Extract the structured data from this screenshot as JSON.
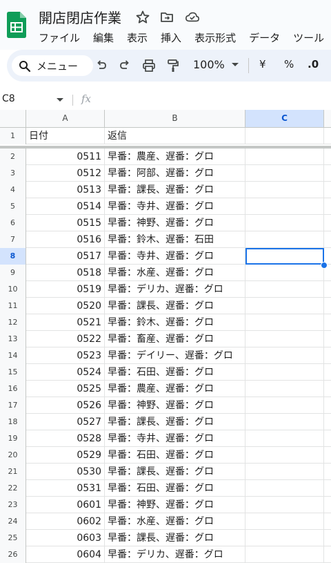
{
  "app": {
    "title": "開店閉店作業",
    "accent": "#0f9d58"
  },
  "menu": [
    "ファイル",
    "編集",
    "表示",
    "挿入",
    "表示形式",
    "データ",
    "ツール"
  ],
  "toolbar": {
    "search_label": "メニュー",
    "zoom": "100%",
    "currency": "¥",
    "percent": "%",
    "decimal": ".0"
  },
  "formula_bar": {
    "cell_ref": "C8",
    "fx": "fx"
  },
  "columns": [
    "A",
    "B",
    "C"
  ],
  "header_row": {
    "num": "1",
    "a": "日付",
    "b": "返信"
  },
  "rows": [
    {
      "num": "2",
      "a": "0511",
      "b": "早番：農産、遅番：グロ"
    },
    {
      "num": "3",
      "a": "0512",
      "b": "早番：阿部、遅番：グロ"
    },
    {
      "num": "4",
      "a": "0513",
      "b": "早番：課長、遅番：グロ"
    },
    {
      "num": "5",
      "a": "0514",
      "b": "早番：寺井、遅番：グロ"
    },
    {
      "num": "6",
      "a": "0515",
      "b": "早番：神野、遅番：グロ"
    },
    {
      "num": "7",
      "a": "0516",
      "b": "早番：鈴木、遅番：石田"
    },
    {
      "num": "8",
      "a": "0517",
      "b": "早番：寺井、遅番：グロ"
    },
    {
      "num": "9",
      "a": "0518",
      "b": "早番：水産、遅番：グロ"
    },
    {
      "num": "10",
      "a": "0519",
      "b": "早番：デリカ、遅番：グロ"
    },
    {
      "num": "11",
      "a": "0520",
      "b": "早番：課長、遅番：グロ"
    },
    {
      "num": "12",
      "a": "0521",
      "b": "早番：鈴木、遅番：グロ"
    },
    {
      "num": "13",
      "a": "0522",
      "b": "早番：畜産、遅番：グロ"
    },
    {
      "num": "14",
      "a": "0523",
      "b": "早番：デイリー、遅番：グロ"
    },
    {
      "num": "15",
      "a": "0524",
      "b": "早番：石田、遅番：グロ"
    },
    {
      "num": "16",
      "a": "0525",
      "b": "早番：農産、遅番：グロ"
    },
    {
      "num": "17",
      "a": "0526",
      "b": "早番：神野、遅番：グロ"
    },
    {
      "num": "18",
      "a": "0527",
      "b": "早番：課長、遅番：グロ"
    },
    {
      "num": "19",
      "a": "0528",
      "b": "早番：寺井、遅番：グロ"
    },
    {
      "num": "20",
      "a": "0529",
      "b": "早番：石田、遅番：グロ"
    },
    {
      "num": "21",
      "a": "0530",
      "b": "早番：課長、遅番：グロ"
    },
    {
      "num": "22",
      "a": "0531",
      "b": "早番：石田、遅番：グロ"
    },
    {
      "num": "23",
      "a": "0601",
      "b": "早番：神野、遅番：グロ"
    },
    {
      "num": "24",
      "a": "0602",
      "b": "早番：水産、遅番：グロ"
    },
    {
      "num": "25",
      "a": "0603",
      "b": "早番：課長、遅番：グロ"
    },
    {
      "num": "26",
      "a": "0604",
      "b": "早番：デリカ、遅番：グロ"
    }
  ],
  "selected_cell": "C8"
}
